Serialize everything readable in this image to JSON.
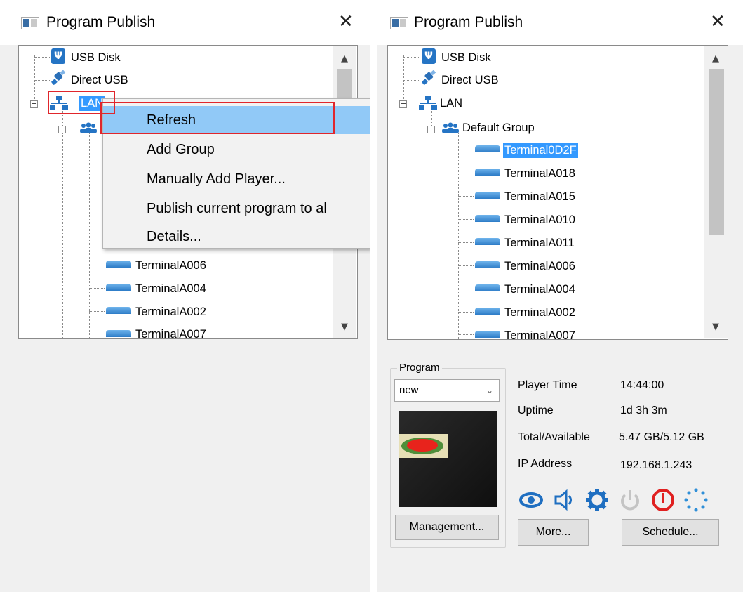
{
  "window": {
    "title": "Program Publish",
    "close_glyph": "✕"
  },
  "tree": {
    "usb_disk": "USB Disk",
    "direct_usb": "Direct USB",
    "lan": "LAN",
    "lan_partial": "LAN",
    "default_group": "Default Group",
    "terminals": [
      "Terminal0D2F",
      "TerminalA018",
      "TerminalA015",
      "TerminalA010",
      "TerminalA011",
      "TerminalA006",
      "TerminalA004",
      "TerminalA002",
      "TerminalA007"
    ],
    "selected": "Terminal0D2F"
  },
  "context_menu": {
    "items": [
      "Refresh",
      "Add Group",
      "Manually Add Player...",
      "Publish current program to al",
      "Details..."
    ],
    "highlighted": "Refresh"
  },
  "program": {
    "group_label": "Program",
    "selected_program": "new",
    "management_button": "Management..."
  },
  "player_info": {
    "player_time_label": "Player Time",
    "player_time": "14:44:00",
    "uptime_label": "Uptime",
    "uptime": "1d 3h 3m",
    "storage_label": "Total/Available",
    "storage": "5.47 GB/5.12 GB",
    "ip_label": "IP Address",
    "ip": "192.168.1.243"
  },
  "toolbar_icons": [
    "eye-icon",
    "speaker-icon",
    "gear-icon",
    "power-icon",
    "restart-icon",
    "dots-ring-icon"
  ],
  "buttons": {
    "more": "More...",
    "schedule": "Schedule..."
  },
  "colors": {
    "selection": "#3399ff",
    "menu_highlight": "#91c9f7",
    "annotation_red": "#e0262c",
    "icon_blue": "#2574c4"
  }
}
